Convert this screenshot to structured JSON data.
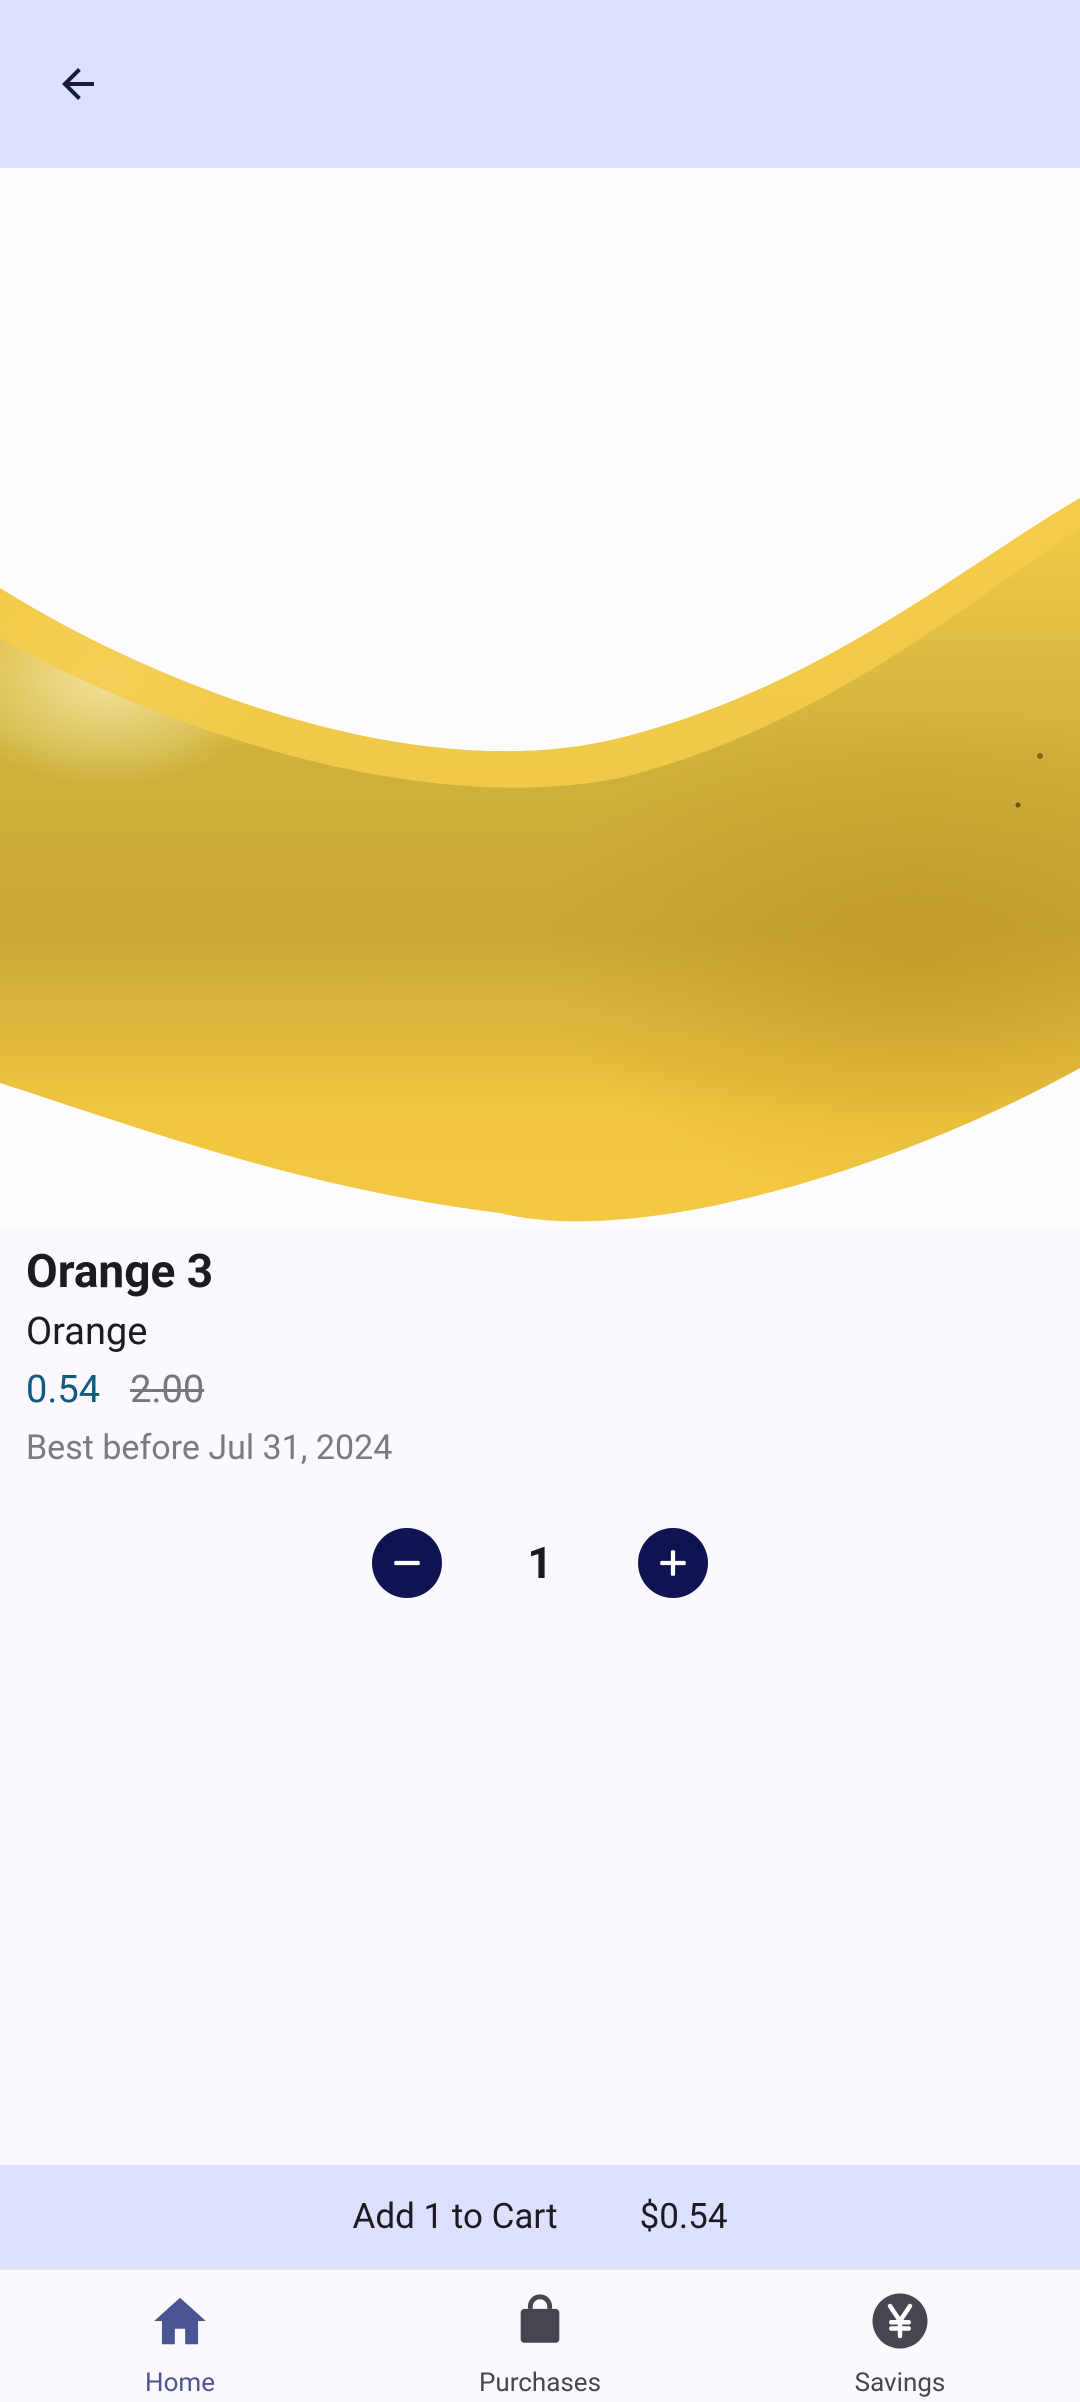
{
  "product": {
    "name": "Orange 3",
    "category": "Orange",
    "price": "0.54",
    "original_price": "2.00",
    "best_before": "Best before Jul 31, 2024",
    "image_icon": "banana-image"
  },
  "quantity": {
    "value": "1",
    "decrement_icon": "minus-icon",
    "increment_icon": "plus-icon"
  },
  "cart": {
    "label": "Add 1 to Cart",
    "total": "$0.54"
  },
  "nav": {
    "items": [
      {
        "label": "Home",
        "icon": "home-icon",
        "active": true
      },
      {
        "label": "Purchases",
        "icon": "shopping-bag-icon",
        "active": false
      },
      {
        "label": "Savings",
        "icon": "yen-icon",
        "active": false
      }
    ]
  },
  "colors": {
    "top_bar": "#dde0ff",
    "accent": "#0f1352",
    "price": "#0d5b7e",
    "nav_active": "#4c5594"
  }
}
